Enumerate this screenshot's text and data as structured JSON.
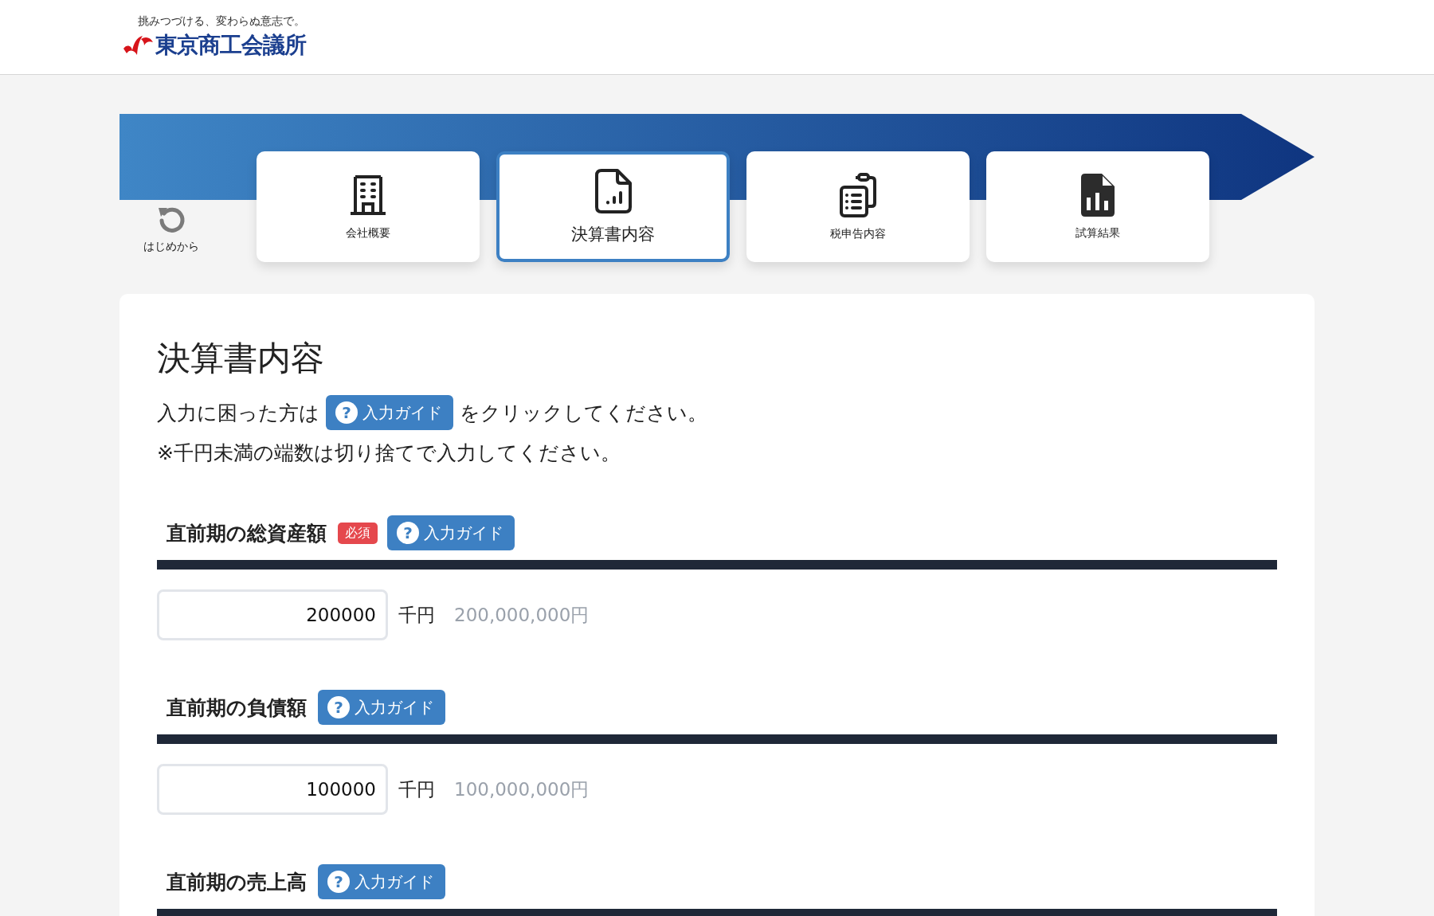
{
  "header": {
    "tagline": "挑みつづける、変わらぬ意志で。",
    "org_name": "東京商工会議所"
  },
  "restart": {
    "label": "はじめから"
  },
  "steps": [
    {
      "label": "会社概要",
      "selected": false
    },
    {
      "label": "決算書内容",
      "selected": true
    },
    {
      "label": "税申告内容",
      "selected": false
    },
    {
      "label": "試算結果",
      "selected": false
    }
  ],
  "page": {
    "title": "決算書内容",
    "intro_before": "入力に困った方は",
    "intro_guide": {
      "icon": "?",
      "label": "入力ガイド"
    },
    "intro_after": "をクリックしてください。",
    "note": "※千円未満の端数は切り捨てで入力してください。"
  },
  "fields": [
    {
      "label": "直前期の総資産額",
      "badge": "必須",
      "guide": {
        "icon": "?",
        "label": "入力ガイド"
      },
      "value": "200000",
      "unit": "千円",
      "converted": "200,000,000円"
    },
    {
      "label": "直前期の負債額",
      "guide": {
        "icon": "?",
        "label": "入力ガイド"
      },
      "value": "100000",
      "unit": "千円",
      "converted": "100,000,000円"
    },
    {
      "label": "直前期の売上高",
      "guide": {
        "icon": "?",
        "label": "入力ガイド"
      }
    }
  ]
}
